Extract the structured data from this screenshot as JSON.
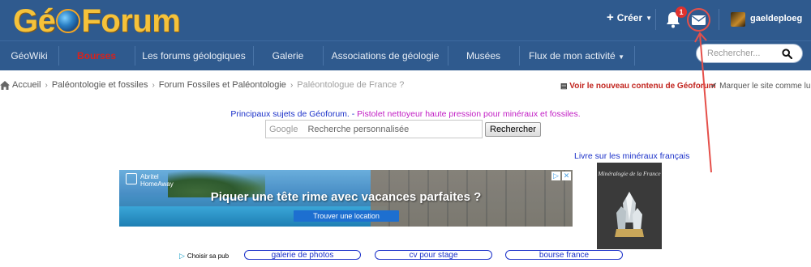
{
  "header": {
    "logo_text_left": "Gé",
    "logo_text_right": "Forum",
    "create_label": "Créer",
    "notification_count": "1",
    "username": "gaeldeploeg",
    "colors": {
      "header_bg": "#2f5a8e",
      "logo": "#f5c23a",
      "highlight_ring": "#e5504a"
    }
  },
  "nav": {
    "items": [
      {
        "label": "GéoWiki"
      },
      {
        "label": "Bourses"
      },
      {
        "label": "Les forums géologiques"
      },
      {
        "label": "Galerie"
      },
      {
        "label": "Associations de géologie"
      },
      {
        "label": "Musées"
      },
      {
        "label": "Flux de mon activité"
      }
    ],
    "search_placeholder": "Rechercher..."
  },
  "breadcrumb": {
    "items": [
      "Accueil",
      "Paléontologie et fossiles",
      "Forum Fossiles et Paléontologie",
      "Paléontologue de France ?"
    ],
    "new_content": "Voir le nouveau contenu de Géoforum",
    "mark_read": "Marquer le site comme lu"
  },
  "main": {
    "topics_prefix": "Principaux sujets de Géoforum. - ",
    "topics_link": "Pistolet nettoyeur haute pression pour minéraux et fossiles.",
    "google_label": "Google",
    "search_placeholder": "Recherche personnalisée",
    "search_button": "Rechercher",
    "book_link": "Livre sur les minéraux français",
    "book_title": "Minéralogie de la France"
  },
  "ad": {
    "brand_line1": "Abritel",
    "brand_line2": "HomeAway",
    "headline": "Piquer une tête rime avec vacances parfaites ?",
    "cta": "Trouver une location"
  },
  "bottom": {
    "choisir": "Choisir sa pub",
    "links": [
      "galerie de photos",
      "cv pour stage",
      "bourse france"
    ]
  }
}
